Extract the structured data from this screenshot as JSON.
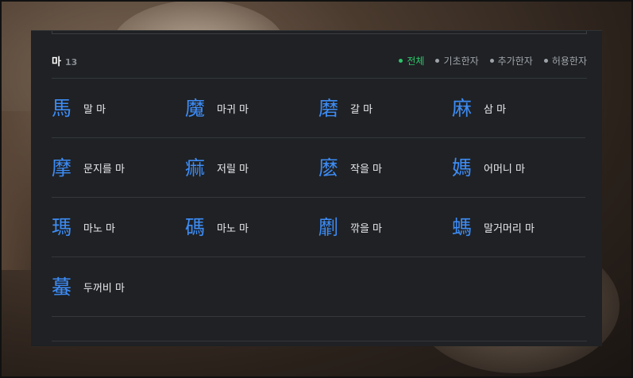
{
  "header": {
    "title": "마",
    "count": "13"
  },
  "filters": [
    {
      "label": "전체",
      "active": true
    },
    {
      "label": "기초한자",
      "active": false
    },
    {
      "label": "추가한자",
      "active": false
    },
    {
      "label": "허용한자",
      "active": false
    }
  ],
  "colors": {
    "accent_green": "#2bc46a",
    "hanja_blue": "#3d8cf5",
    "panel_bg": "#1f2124"
  },
  "rows": [
    [
      {
        "hanja": "馬",
        "meaning": "말 마"
      },
      {
        "hanja": "魔",
        "meaning": "마귀 마"
      },
      {
        "hanja": "磨",
        "meaning": "갈 마"
      },
      {
        "hanja": "麻",
        "meaning": "삼 마"
      }
    ],
    [
      {
        "hanja": "摩",
        "meaning": "문지를 마"
      },
      {
        "hanja": "痲",
        "meaning": "저릴 마"
      },
      {
        "hanja": "麽",
        "meaning": "작을 마"
      },
      {
        "hanja": "媽",
        "meaning": "어머니 마"
      }
    ],
    [
      {
        "hanja": "瑪",
        "meaning": "마노 마"
      },
      {
        "hanja": "碼",
        "meaning": "마노 마"
      },
      {
        "hanja": "劘",
        "meaning": "깎을 마"
      },
      {
        "hanja": "螞",
        "meaning": "말거머리 마"
      }
    ],
    [
      {
        "hanja": "蟇",
        "meaning": "두꺼비 마"
      }
    ]
  ]
}
